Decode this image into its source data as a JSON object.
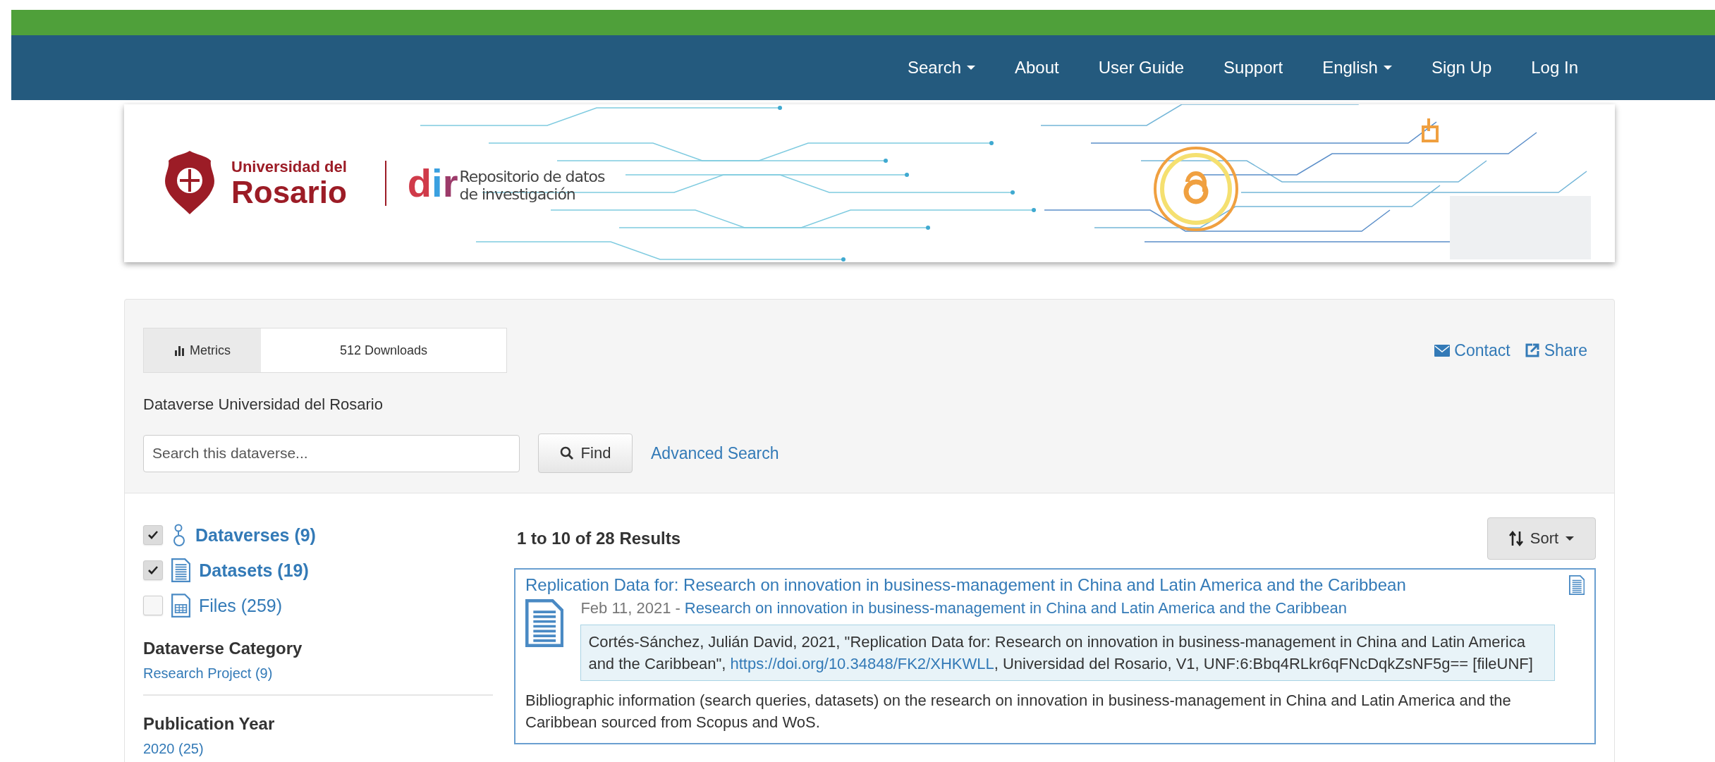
{
  "nav": {
    "items": [
      {
        "label": "Search",
        "dropdown": true
      },
      {
        "label": "About",
        "dropdown": false
      },
      {
        "label": "User Guide",
        "dropdown": false
      },
      {
        "label": "Support",
        "dropdown": false
      },
      {
        "label": "English",
        "dropdown": true
      },
      {
        "label": "Sign Up",
        "dropdown": false
      },
      {
        "label": "Log In",
        "dropdown": false
      }
    ]
  },
  "banner": {
    "university_line1": "Universidad del",
    "university_line2": "Rosario",
    "logo_letters": [
      "d",
      "i",
      "r"
    ],
    "repository_line1": "Repositorio de datos",
    "repository_line2": "de investigación"
  },
  "metrics": {
    "label": "Metrics",
    "downloads": "512 Downloads"
  },
  "actions": [
    {
      "kind": "contact",
      "label": "Contact"
    },
    {
      "kind": "share",
      "label": "Share"
    }
  ],
  "dataverse_name": "Dataverse Universidad del Rosario",
  "search": {
    "placeholder": "Search this dataverse...",
    "button": "Find",
    "advanced": "Advanced Search"
  },
  "facets": {
    "types": [
      {
        "kind": "dataverse",
        "label": "Dataverses (9)",
        "checked": true
      },
      {
        "kind": "dataset",
        "label": "Datasets (19)",
        "checked": true
      },
      {
        "kind": "file",
        "label": "Files (259)",
        "checked": false
      }
    ],
    "groups": [
      {
        "title": "Dataverse Category",
        "items": [
          "Research Project (9)"
        ]
      },
      {
        "title": "Publication Year",
        "items": [
          "2020 (25)"
        ]
      }
    ]
  },
  "results": {
    "count": "1 to 10 of 28 Results",
    "sort": "Sort",
    "items": [
      {
        "title": "Replication Data for: Research on innovation in business-management in China and Latin America and the Caribbean",
        "date": "Feb 11, 2021",
        "separator": "-",
        "parent": "Research on innovation in business-management in China and Latin America and the Caribbean",
        "citation_before": "Cortés-Sánchez, Julián David, 2021, \"Replication Data for: Research on innovation in business-management in China and Latin America and the Caribbean\",",
        "doi": "https://doi.org/10.34848/FK2/XHKWLL",
        "citation_after": ", Universidad del Rosario, V1, UNF:6:Bbq4RLkr6qFNcDqkZsNF5g== [fileUNF]",
        "description": "Bibliographic information (search queries, datasets) on the research on innovation in business-management in China and Latin America and the Caribbean sourced from Scopus and WoS."
      }
    ]
  }
}
